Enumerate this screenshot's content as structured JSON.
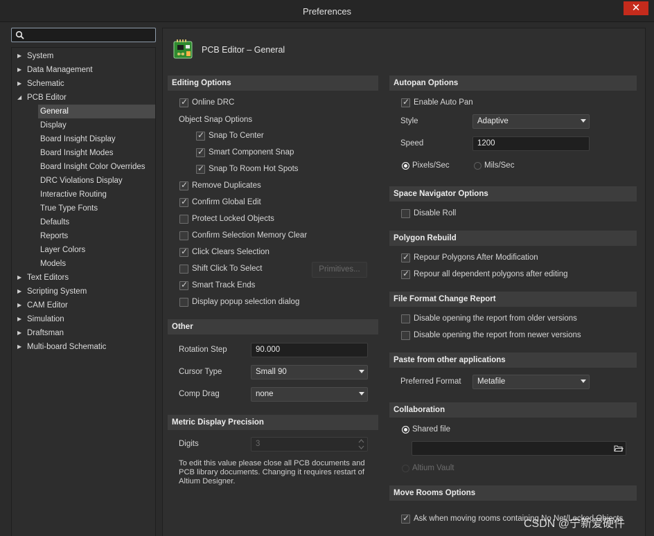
{
  "window": {
    "title": "Preferences",
    "close": "✕"
  },
  "search": {
    "placeholder": ""
  },
  "sidebar": {
    "items": [
      {
        "label": "System",
        "expandable": true
      },
      {
        "label": "Data Management",
        "expandable": true
      },
      {
        "label": "Schematic",
        "expandable": true
      },
      {
        "label": "PCB Editor",
        "expandable": true,
        "expanded": true
      },
      {
        "label": "General",
        "child": true,
        "selected": true
      },
      {
        "label": "Display",
        "child": true
      },
      {
        "label": "Board Insight Display",
        "child": true
      },
      {
        "label": "Board Insight Modes",
        "child": true
      },
      {
        "label": "Board Insight Color Overrides",
        "child": true
      },
      {
        "label": "DRC Violations Display",
        "child": true
      },
      {
        "label": "Interactive Routing",
        "child": true
      },
      {
        "label": "True Type Fonts",
        "child": true
      },
      {
        "label": "Defaults",
        "child": true
      },
      {
        "label": "Reports",
        "child": true
      },
      {
        "label": "Layer Colors",
        "child": true
      },
      {
        "label": "Models",
        "child": true
      },
      {
        "label": "Text Editors",
        "expandable": true
      },
      {
        "label": "Scripting System",
        "expandable": true
      },
      {
        "label": "CAM Editor",
        "expandable": true
      },
      {
        "label": "Simulation",
        "expandable": true
      },
      {
        "label": "Draftsman",
        "expandable": true
      },
      {
        "label": "Multi-board Schematic",
        "expandable": true
      }
    ]
  },
  "page": {
    "title": "PCB Editor – General",
    "icon": "pcb-board-icon"
  },
  "editing": {
    "header": "Editing Options",
    "online_drc": {
      "label": "Online DRC",
      "checked": true
    },
    "snap_group_label": "Object Snap Options",
    "snap_center": {
      "label": "Snap To Center",
      "checked": true
    },
    "smart_component_snap": {
      "label": "Smart Component Snap",
      "checked": true
    },
    "snap_room_hotspots": {
      "label": "Snap To Room Hot Spots",
      "checked": true
    },
    "remove_duplicates": {
      "label": "Remove Duplicates",
      "checked": true
    },
    "confirm_global_edit": {
      "label": "Confirm Global Edit",
      "checked": true
    },
    "protect_locked": {
      "label": "Protect Locked Objects",
      "checked": false
    },
    "confirm_sel_mem_clear": {
      "label": "Confirm Selection Memory Clear",
      "checked": false
    },
    "click_clears_selection": {
      "label": "Click Clears Selection",
      "checked": true
    },
    "shift_click_select": {
      "label": "Shift Click To Select",
      "checked": false
    },
    "primitives_button": "Primitives...",
    "smart_track_ends": {
      "label": "Smart Track Ends",
      "checked": true
    },
    "display_popup": {
      "label": "Display popup selection dialog",
      "checked": false
    }
  },
  "other": {
    "header": "Other",
    "rotation_step_label": "Rotation Step",
    "rotation_step_value": "90.000",
    "cursor_type_label": "Cursor Type",
    "cursor_type_value": "Small 90",
    "comp_drag_label": "Comp Drag",
    "comp_drag_value": "none"
  },
  "metric": {
    "header": "Metric Display Precision",
    "digits_label": "Digits",
    "digits_value": "3",
    "note": "To edit this value please close all PCB documents and PCB library documents. Changing it requires restart of Altium Designer."
  },
  "autopan": {
    "header": "Autopan Options",
    "enable": {
      "label": "Enable Auto Pan",
      "checked": true
    },
    "style_label": "Style",
    "style_value": "Adaptive",
    "speed_label": "Speed",
    "speed_value": "1200",
    "pixels_sec": "Pixels/Sec",
    "mils_sec": "Mils/Sec",
    "unit_selected": "Pixels/Sec"
  },
  "space_nav": {
    "header": "Space Navigator Options",
    "disable_roll": {
      "label": "Disable Roll",
      "checked": false
    }
  },
  "polygon": {
    "header": "Polygon Rebuild",
    "repour_after_mod": {
      "label": "Repour Polygons After Modification",
      "checked": true
    },
    "repour_dependent": {
      "label": "Repour all dependent polygons after editing",
      "checked": true
    }
  },
  "file_format": {
    "header": "File Format Change Report",
    "disable_older": {
      "label": "Disable opening the report from older versions",
      "checked": false
    },
    "disable_newer": {
      "label": "Disable opening the report from newer versions",
      "checked": false
    }
  },
  "paste": {
    "header": "Paste from other applications",
    "preferred_format_label": "Preferred Format",
    "preferred_format_value": "Metafile"
  },
  "collab": {
    "header": "Collaboration",
    "shared_file": "Shared file",
    "shared_path": "",
    "altium_vault": "Altium Vault",
    "selected": "Shared file"
  },
  "move_rooms": {
    "header": "Move Rooms Options",
    "ask_label": "Ask when moving rooms containing No Net/Locked Objects",
    "ask_checked": true
  },
  "watermark": "CSDN @宁新爱硬件"
}
